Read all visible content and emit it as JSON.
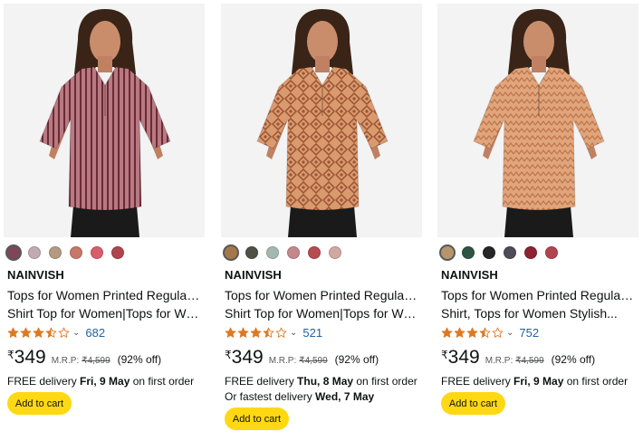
{
  "products": [
    {
      "brand": "NAINVISH",
      "title_line1": "Tops for Women Printed Regular Fit",
      "title_line2": "Shirt Top for Women|Tops for Wom...",
      "rating": 3.5,
      "rating_count": "682",
      "currency": "₹",
      "price": "349",
      "mrp_label": "M.R.P:",
      "mrp": "₹4,599",
      "discount": "(92% off)",
      "delivery_prefix": "FREE delivery ",
      "delivery_date": "Fri, 9 May",
      "delivery_suffix": " on first order",
      "fast_prefix": "",
      "fast_date": "",
      "cart_label": "Add to cart",
      "swatches": [
        "#7e4656",
        "#c3aab2",
        "#b49a82",
        "#c6786a",
        "#d95e6b",
        "#b0454e"
      ],
      "selected_swatch": 0,
      "garment_color": "#b87a82",
      "stripe_color": "#6b2a36"
    },
    {
      "brand": "NAINVISH",
      "title_line1": "Tops for Women Printed Regular Fit",
      "title_line2": "Shirt Top for Women|Tops for Wom...",
      "rating": 3.5,
      "rating_count": "521",
      "currency": "₹",
      "price": "349",
      "mrp_label": "M.R.P:",
      "mrp": "₹4,599",
      "discount": "(92% off)",
      "delivery_prefix": "FREE delivery ",
      "delivery_date": "Thu, 8 May",
      "delivery_suffix": " on first order",
      "fast_prefix": "Or fastest delivery ",
      "fast_date": "Wed, 7 May",
      "cart_label": "Add to cart",
      "swatches": [
        "#a67849",
        "#4e5246",
        "#a4b9ae",
        "#c3888a",
        "#b44c50",
        "#cfa8a4"
      ],
      "selected_swatch": 0,
      "garment_color": "#d99a6e",
      "stripe_color": "#9c5233"
    },
    {
      "brand": "NAINVISH",
      "title_line1": "Tops for Women Printed Regular Fit",
      "title_line2": "Shirt, Tops for Women Stylish...",
      "rating": 3.5,
      "rating_count": "752",
      "currency": "₹",
      "price": "349",
      "mrp_label": "M.R.P:",
      "mrp": "₹4,599",
      "discount": "(92% off)",
      "delivery_prefix": "FREE delivery ",
      "delivery_date": "Fri, 9 May",
      "delivery_suffix": " on first order",
      "fast_prefix": "",
      "fast_date": "",
      "cart_label": "Add to cart",
      "swatches": [
        "#b7956c",
        "#2f5443",
        "#262626",
        "#4f4b58",
        "#8d2232",
        "#b24450"
      ],
      "selected_swatch": 0,
      "garment_color": "#e0a57c",
      "stripe_color": "#c07548"
    }
  ],
  "colors": {
    "star": "#de7921",
    "link": "#2162a1",
    "cart_button": "#ffd814"
  }
}
